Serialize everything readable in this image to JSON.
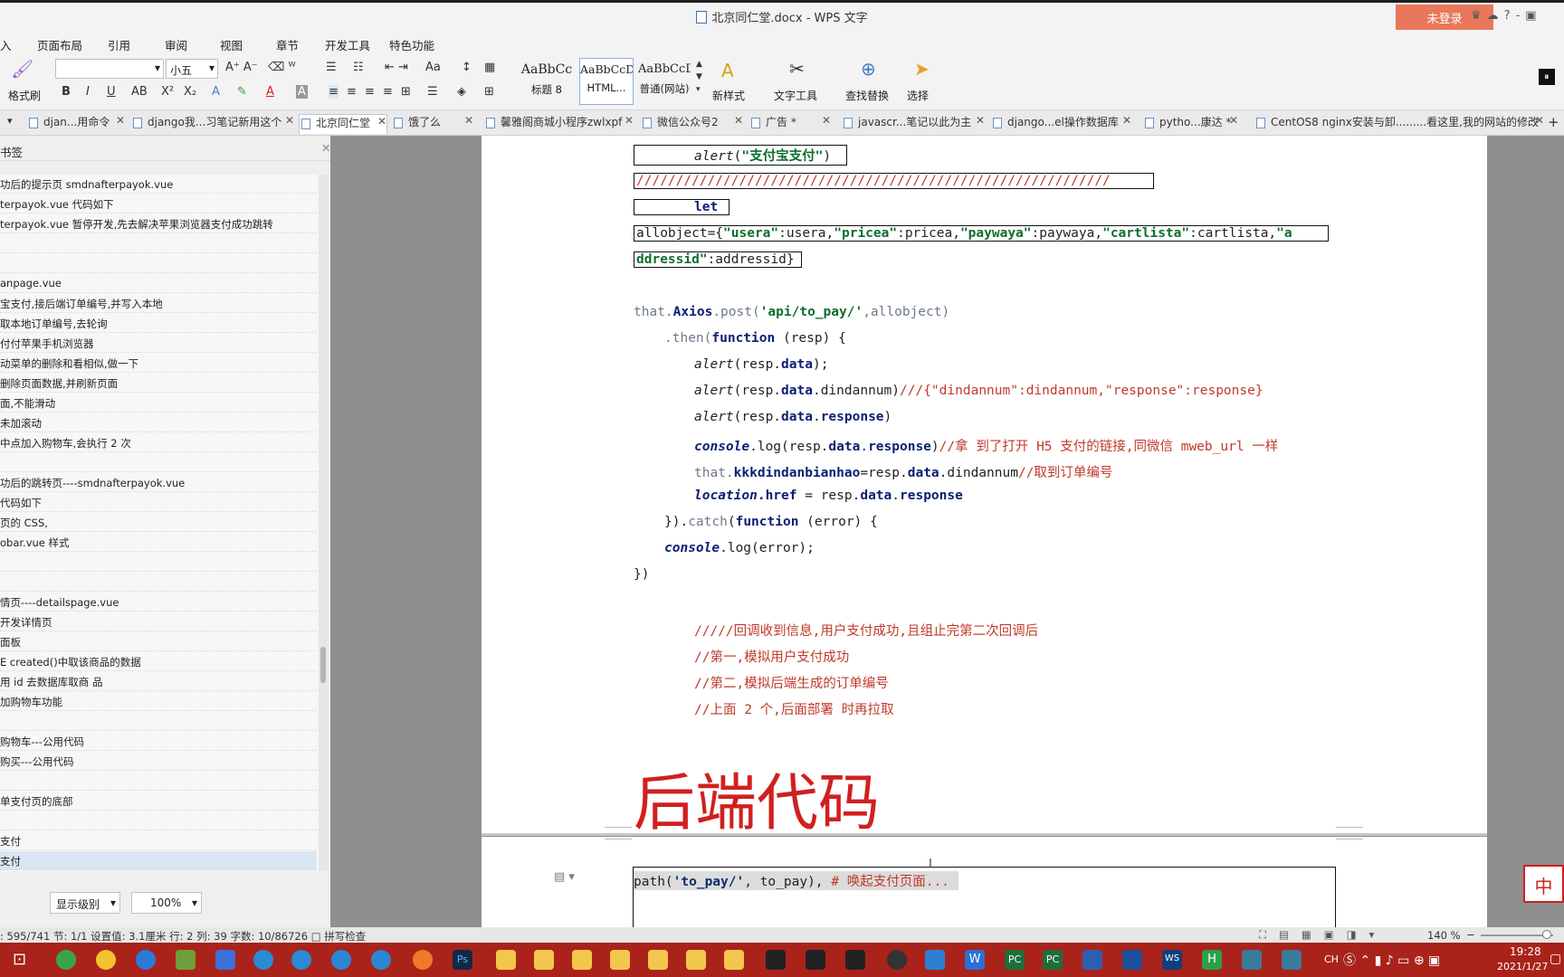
{
  "window": {
    "title": "北京同仁堂.docx - WPS 文字",
    "login": "未登录"
  },
  "menu": [
    "入",
    "页面布局",
    "引用",
    "审阅",
    "视图",
    "章节",
    "开发工具",
    "特色功能"
  ],
  "ribbon": {
    "format_painter": "格式刷",
    "font_size": "小五",
    "styles": [
      {
        "sample": "AaBbCc",
        "name": "标题 8"
      },
      {
        "sample": "AaBbCcDd",
        "name": "HTML..."
      },
      {
        "sample": "AaBbCcD",
        "name": "普通(网站)"
      }
    ],
    "new_style": "新样式",
    "text_tools": "文字工具",
    "find_replace": "查找替换",
    "select": "选择"
  },
  "tabs": [
    "djan...用命令",
    "django我...习笔记新用这个",
    "北京同仁堂",
    "饿了么",
    "馨雅阁商城小程序zwlxpf",
    "微信公众号2",
    "广告 *",
    "javascr...笔记以此为主",
    "django...el操作数据库",
    "pytho...康达 *",
    "CentOS8 nginx安装与卸.........看这里,我的网站的修改"
  ],
  "sidebar": {
    "title": "书签",
    "items": [
      "功后的提示页         smdnafterpayok.vue",
      "terpayok.vue 代码如下",
      "terpayok.vue 暂停开发,先去解决苹果浏览器支付成功跳转",
      "",
      "",
      "anpage.vue",
      "宝支付,接后端订单编号,并写入本地",
      "取本地订单编号,去轮询",
      "付付苹果手机浏览器",
      "动菜单的删除和看相似,做一下",
      "删除页面数据,并刷新页面",
      "面,不能滑动",
      "未加滚动",
      "中点加入购物车,会执行 2 次",
      "",
      "功后的跳转页----smdnafterpayok.vue",
      "代码如下",
      "页的 CSS,",
      "obar.vue 样式",
      "",
      "",
      "情页----detailspage.vue",
      "开发详情页",
      "面板",
      "E created()中取该商品的数据",
      "用 id 去数据库取商  品",
      "加购物车功能",
      "",
      "购物车---公用代码",
      "购买---公用代码",
      "",
      "单支付页的底部",
      "",
      "支付",
      "支付"
    ],
    "level_label": "显示级别",
    "zoom": "100%"
  },
  "code": {
    "l1_fn": "alert",
    "l1_str": "\"支付宝支付\"",
    "l2": "////////////////////////////////////////////////////////////",
    "l3": "let",
    "l4a": "allobject={",
    "l4b": "\"usera\"",
    "l4c": ":usera,",
    "l4d": "\"pricea\"",
    "l4e": ":pricea,",
    "l4f": "\"paywaya\"",
    "l4g": ":paywaya,",
    "l4h": "\"cartlista\"",
    "l4i": ":cartlista,",
    "l4j": "\"a",
    "l5a": "ddressid\"",
    "l5b": ":addressid}",
    "l6a": "that.",
    "l6b": "Axios",
    "l6c": ".post(",
    "l6d": "'api/to_pay/'",
    "l6e": ",allobject)",
    "l7a": ".then(",
    "l7b": "function",
    "l7c": " (resp) {",
    "l8a": "alert",
    "l8b": "(resp.",
    "l8c": "data",
    "l8d": ");",
    "l9c": "dindannum)",
    "l9d": "///{\"dindannum\":dindannum,\"response\":response}",
    "l10c": "response",
    "l10d": ")",
    "l11a": "console",
    "l11b": ".log(resp.",
    "l11c": "data",
    "l11d": ".",
    "l11e": "response",
    "l11f": ")",
    "l11g": "//拿  到了打开 H5 支付的链接,同微信 mweb_url 一样",
    "l12a": "that.",
    "l12b": "kkkdindanbianhao",
    "l12c": "=resp.",
    "l12d": "data",
    "l12e": ".dindannum",
    "l12f": "//取到订单编号",
    "l13a": "location",
    "l13b": ".href",
    "l13c": " = resp.",
    "l13d": "data",
    "l13e": ".",
    "l13f": "response",
    "l14a": "}).",
    "l14b": "catch",
    "l14c": "(",
    "l14d": "function",
    "l14e": " (error) {",
    "l15a": "console",
    "l15b": ".log(error);",
    "l16": "})",
    "c1": "/////回调收到信息,用户支付成功,且组止完第二次回调后",
    "c2": "//第一,模拟用户支付成功",
    "c3": "//第二,模拟后端生成的订单编号",
    "c4": "//上面 2 个,后面部署  时再拉取",
    "heading": "后端代码",
    "p2a": "path(",
    "p2b": "'to_pay/'",
    "p2c": ", to_pay),  ",
    "p2d": "# 唤起支付页面..."
  },
  "status": {
    "text": ": 595/741  节: 1/1  设置值: 3.1厘米  行: 2  列: 39  字数: 10/86726  □ 拼写检查",
    "zoom": "140 %"
  },
  "taskbar": {
    "ime": "CH",
    "time": "19:28",
    "date": "2021/1/27"
  }
}
